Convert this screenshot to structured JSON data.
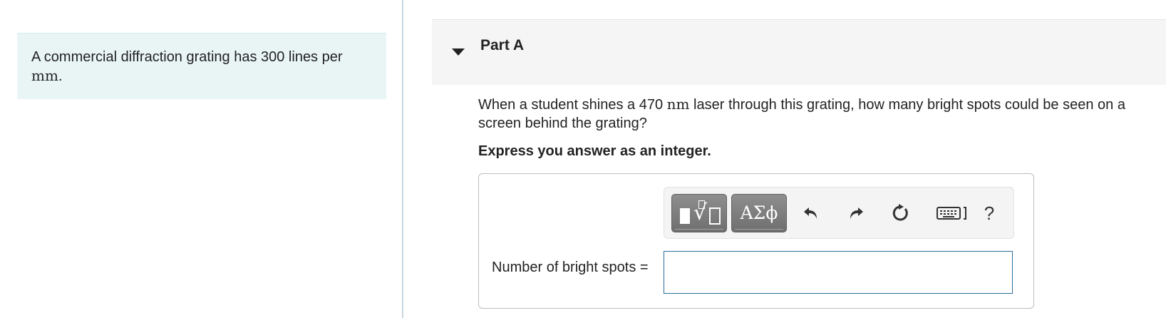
{
  "intro": {
    "text": "A commercial diffraction grating has 300 lines per",
    "unit": "mm",
    "end": "."
  },
  "part": {
    "title": "Part A",
    "toggle_icon": "collapse-triangle-icon"
  },
  "question": {
    "before": "When a student shines a 470 ",
    "unit": "nm",
    "after": " laser through this grating, how many bright spots could be seen on a screen behind the grating?"
  },
  "instruction": "Express you answer as an integer.",
  "toolbar": {
    "templates_icon": "templates-sqrt-icon",
    "greek_label": "ΑΣϕ",
    "undo_icon": "undo-icon",
    "redo_icon": "redo-icon",
    "reset_icon": "reset-icon",
    "keyboard_icon": "keyboard-icon",
    "help_label": "?"
  },
  "answer": {
    "label": "Number of bright spots =",
    "value": "",
    "placeholder": ""
  },
  "colors": {
    "intro_bg": "#e9f5f5",
    "part_header_bg": "#f5f5f5",
    "toolbar_button": "#7f7f7f",
    "input_border": "#2b6d98"
  }
}
